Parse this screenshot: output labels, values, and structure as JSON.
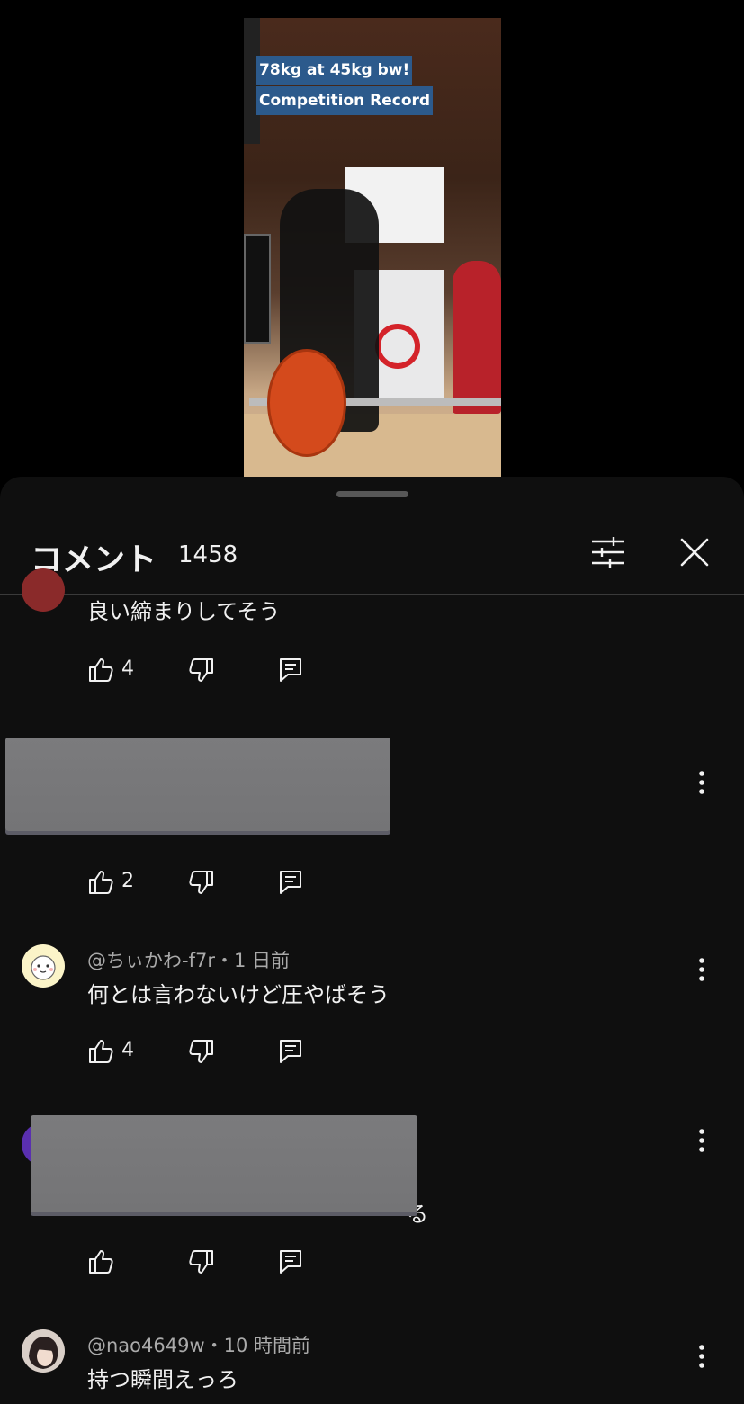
{
  "video": {
    "overlay_line1": "78kg at 45kg bw!",
    "overlay_line2": "Competition Record"
  },
  "header": {
    "title": "コメント",
    "count": "1458",
    "filter_icon": "sliders-icon",
    "close_icon": "close-icon"
  },
  "comments": [
    {
      "author": "",
      "time": "",
      "text": "良い締まりしてそう",
      "likes": "4"
    },
    {
      "author": "",
      "time": "",
      "text": "",
      "likes": "2",
      "redacted": true
    },
    {
      "author": "@ちぃかわ-f7r",
      "time": "1 日前",
      "text": "何とは言わないけど圧やばそう",
      "likes": "4"
    },
    {
      "author": "",
      "time": "",
      "text": "る",
      "likes": "",
      "redacted": true
    },
    {
      "author": "@nao4649w",
      "time": "10 時間前",
      "text": "持つ瞬間えっろ",
      "likes": ""
    }
  ],
  "meta_separator": "・",
  "colors": {
    "sheet_bg": "#0f0f0f",
    "text": "#f1f1f1",
    "meta": "#aaaaaa",
    "divider": "#3a3a3a"
  }
}
